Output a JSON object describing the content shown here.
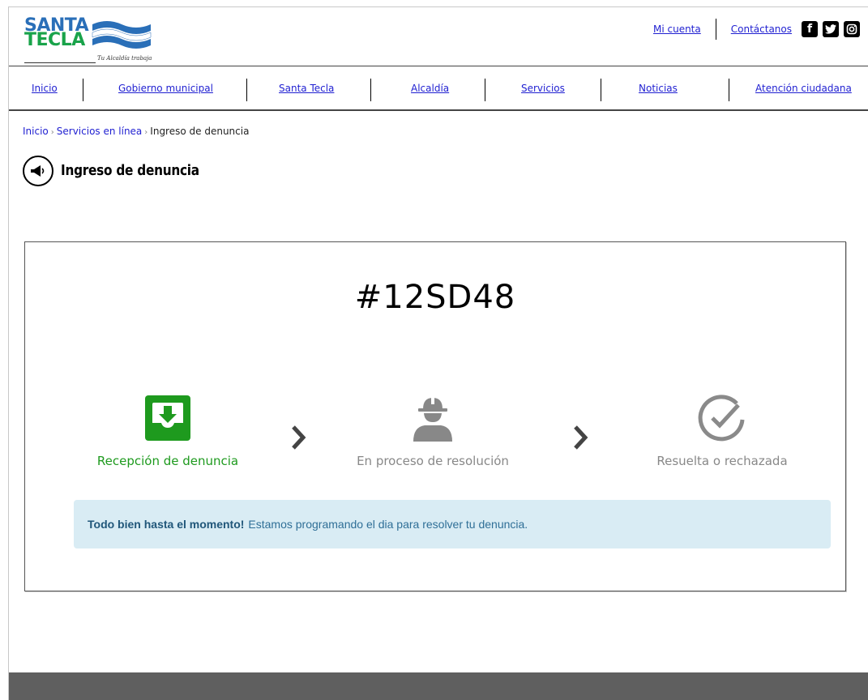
{
  "logo": {
    "line1": "SANTA",
    "line2": "TECLA",
    "tagline": "Tu Alcaldía trabaja"
  },
  "header": {
    "links": [
      "Mi cuenta",
      "Contáctanos"
    ],
    "social": [
      {
        "icon": "facebook-icon",
        "glyph": "f"
      },
      {
        "icon": "twitter-icon",
        "glyph": "t"
      },
      {
        "icon": "instagram-icon",
        "glyph": "◎"
      }
    ]
  },
  "nav": {
    "items": [
      "Inicio",
      "Gobierno municipal",
      "Santa Tecla",
      "Alcaldía",
      "Servicios",
      "Noticias",
      "Atención ciudadana"
    ]
  },
  "breadcrumb": {
    "items": [
      "Inicio",
      "Servicios en línea"
    ],
    "current": "Ingreso de denuncia",
    "separator": "›"
  },
  "page": {
    "title": "Ingreso de denuncia",
    "title_icon": "megaphone-icon"
  },
  "ticket": {
    "code": "#12SD48"
  },
  "steps": [
    {
      "label": "Recepción de denuncia",
      "icon": "inbox-download-icon",
      "state": "active",
      "color": "#1e9a1e"
    },
    {
      "label": "En proceso de resolución",
      "icon": "worker-icon",
      "state": "pending",
      "color": "#888888"
    },
    {
      "label": "Resuelta o rechazada",
      "icon": "check-circle-icon",
      "state": "pending",
      "color": "#888888"
    }
  ],
  "alert": {
    "strong": "Todo bien hasta el momento!",
    "text": "Estamos programando el dia para resolver tu denuncia."
  },
  "colors": {
    "link": "#1f1fd1",
    "active": "#1e9a1e",
    "inactive": "#888888",
    "alert_bg": "#d9ecf4",
    "footer": "#5f5f5f"
  }
}
